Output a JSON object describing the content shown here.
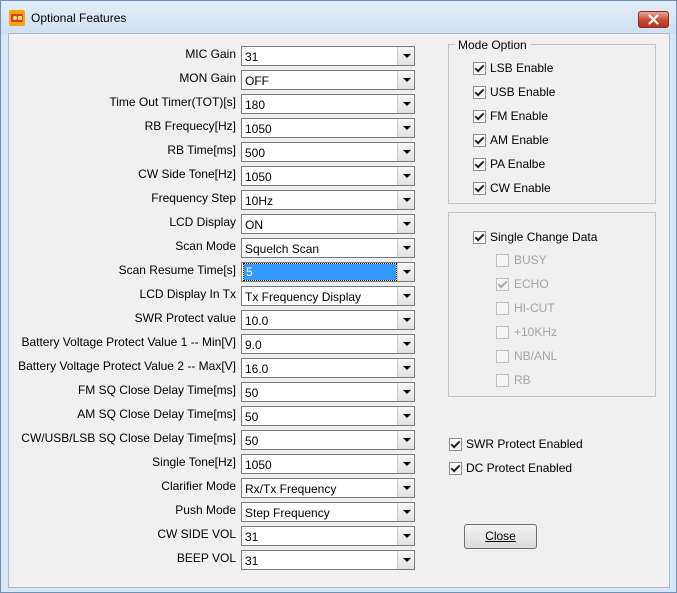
{
  "window": {
    "title": "Optional Features"
  },
  "settings": [
    {
      "label": "MIC Gain",
      "value": "31"
    },
    {
      "label": "MON Gain",
      "value": "OFF"
    },
    {
      "label": "Time Out Timer(TOT)[s]",
      "value": "180"
    },
    {
      "label": "RB Frequecy[Hz]",
      "value": "1050"
    },
    {
      "label": "RB Time[ms]",
      "value": "500"
    },
    {
      "label": "CW Side Tone[Hz]",
      "value": "1050"
    },
    {
      "label": "Frequency Step",
      "value": "10Hz"
    },
    {
      "label": "LCD Display",
      "value": "ON"
    },
    {
      "label": "Scan Mode",
      "value": "Squelch Scan"
    },
    {
      "label": "Scan Resume Time[s]",
      "value": "5",
      "selected": true
    },
    {
      "label": "LCD Display In Tx",
      "value": "Tx Frequency Display"
    },
    {
      "label": "SWR Protect value",
      "value": "10.0"
    },
    {
      "label": "Battery Voltage Protect Value 1 -- Min[V]",
      "value": "9.0"
    },
    {
      "label": "Battery Voltage Protect Value 2 -- Max[V]",
      "value": "16.0"
    },
    {
      "label": "FM SQ Close Delay Time[ms]",
      "value": "50"
    },
    {
      "label": "AM SQ Close Delay Time[ms]",
      "value": "50"
    },
    {
      "label": "CW/USB/LSB SQ Close Delay Time[ms]",
      "value": "50"
    },
    {
      "label": "Single Tone[Hz]",
      "value": "1050"
    },
    {
      "label": "Clarifier Mode",
      "value": "Rx/Tx Frequency"
    },
    {
      "label": "Push Mode",
      "value": "Step Frequency"
    },
    {
      "label": "CW SIDE VOL",
      "value": "31"
    },
    {
      "label": "BEEP VOL",
      "value": "31"
    }
  ],
  "mode_option": {
    "title": "Mode Option",
    "items": [
      {
        "label": "LSB Enable",
        "checked": true
      },
      {
        "label": "USB Enable",
        "checked": true
      },
      {
        "label": "FM Enable",
        "checked": true
      },
      {
        "label": "AM Enable",
        "checked": true
      },
      {
        "label": "PA Enalbe",
        "checked": true
      },
      {
        "label": "CW Enable",
        "checked": true
      }
    ]
  },
  "single_change": {
    "label": "Single Change Data",
    "checked": true,
    "items": [
      {
        "label": "BUSY",
        "checked": false
      },
      {
        "label": "ECHO",
        "checked": true
      },
      {
        "label": "HI-CUT",
        "checked": false
      },
      {
        "label": "+10KHz",
        "checked": false
      },
      {
        "label": "NB/ANL",
        "checked": false
      },
      {
        "label": "RB",
        "checked": false
      }
    ]
  },
  "protect": [
    {
      "label": "SWR Protect Enabled",
      "checked": true
    },
    {
      "label": "DC Protect Enabled",
      "checked": true
    }
  ],
  "close_button": "Close"
}
